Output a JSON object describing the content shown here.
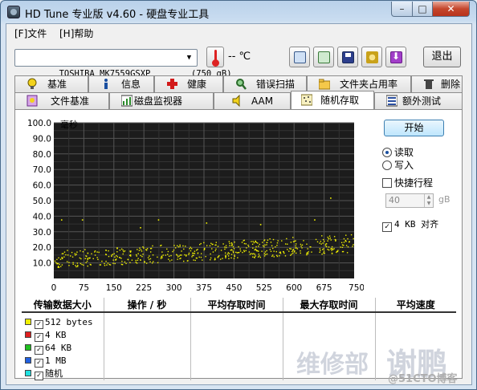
{
  "window": {
    "title": "HD Tune 专业版 v4.60 - 硬盘专业工具",
    "minimize": "–",
    "maximize": "□",
    "close": "✕"
  },
  "menu": {
    "file": "[F]文件",
    "help": "[H]帮助"
  },
  "toolbar": {
    "drive": "TOSHIBA MK7559GSXP        (750 gB)",
    "temperature": "-- ℃",
    "exit_label": "退出",
    "buttons": [
      "copy-text-icon",
      "copy-screenshot-icon",
      "save-icon",
      "options-icon",
      "download-icon"
    ]
  },
  "tabs_row1": [
    "基准",
    "信息",
    "健康",
    "错误扫描",
    "文件夹占用率",
    "删除"
  ],
  "tabs_row2": [
    "文件基准",
    "磁盘监视器",
    "AAM",
    "随机存取",
    "额外测试"
  ],
  "active_tab": "随机存取",
  "controls": {
    "start_label": "开始",
    "read_label": "读取",
    "write_label": "写入",
    "quick_label": "快捷行程",
    "quick_value": "40",
    "quick_unit": "gB",
    "align_label": "4 KB 对齐"
  },
  "results": {
    "headers": [
      "传输数据大小",
      "操作 / 秒",
      "平均存取时间",
      "最大存取时间",
      "平均速度"
    ],
    "rows": [
      {
        "label": "512 bytes",
        "color": "#f0f000"
      },
      {
        "label": "4 KB",
        "color": "#e02020"
      },
      {
        "label": "64 KB",
        "color": "#20c020"
      },
      {
        "label": "1 MB",
        "color": "#2060e0"
      },
      {
        "label": "随机",
        "color": "#20e0e0"
      }
    ]
  },
  "watermarks": [
    "维修部",
    "谢鹏",
    "@51CTO博客"
  ],
  "chart_data": {
    "type": "scatter",
    "ylabel": "毫秒",
    "xlabel_unit": "gB",
    "ylim": [
      0,
      100
    ],
    "xlim": [
      0,
      750
    ],
    "yticks": [
      "10.0",
      "20.0",
      "30.0",
      "40.0",
      "50.0",
      "60.0",
      "70.0",
      "80.0",
      "90.0",
      "100.0"
    ],
    "xticks": [
      "0",
      "75",
      "150",
      "225",
      "300",
      "375",
      "450",
      "525",
      "600",
      "675",
      "750gB"
    ],
    "series": [
      {
        "color": "#f0f000",
        "trend": {
          "x": [
            0,
            750
          ],
          "y_low": [
            7,
            17
          ],
          "y_high": [
            18,
            29
          ]
        },
        "outliers": [
          [
            18,
            38
          ],
          [
            70,
            38
          ],
          [
            260,
            38
          ],
          [
            380,
            36
          ],
          [
            515,
            35
          ],
          [
            650,
            38
          ],
          [
            690,
            52
          ],
          [
            215,
            33
          ]
        ]
      }
    ],
    "background": "#1c1c1c",
    "grid": true
  }
}
